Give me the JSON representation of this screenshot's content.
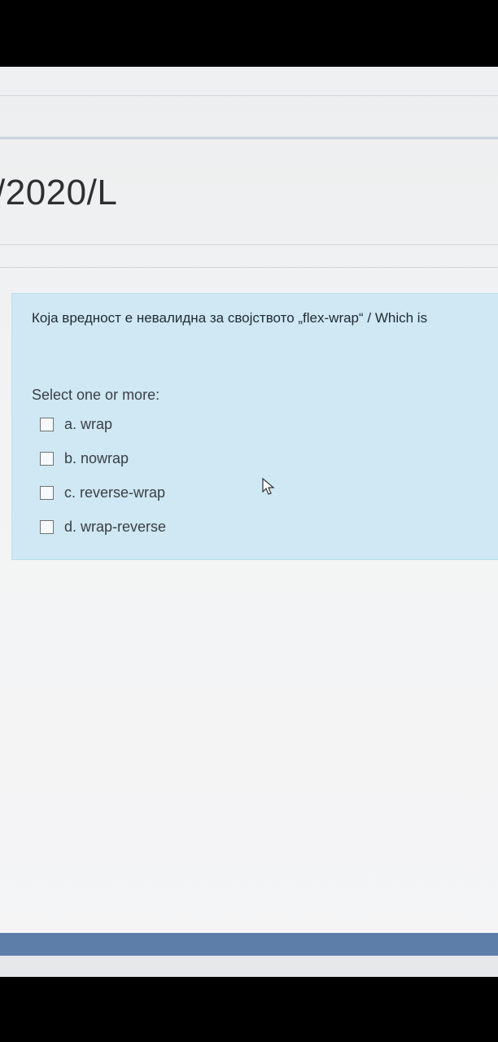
{
  "course": {
    "title": "/2020/L"
  },
  "question": {
    "text": "Која вредност е невалидна за својството „flex-wrap“ / Which is",
    "prompt": "Select one or more:",
    "options": [
      {
        "label": "a. wrap",
        "checked": false
      },
      {
        "label": "b. nowrap",
        "checked": false
      },
      {
        "label": "c. reverse-wrap",
        "checked": false
      },
      {
        "label": "d. wrap-reverse",
        "checked": false
      }
    ]
  },
  "colors": {
    "question_box": "#cfe8f3",
    "bottom_bar": "#5d7ea8"
  },
  "icons": {
    "cursor": "mouse-pointer-icon",
    "checkbox": "checkbox-icon"
  }
}
